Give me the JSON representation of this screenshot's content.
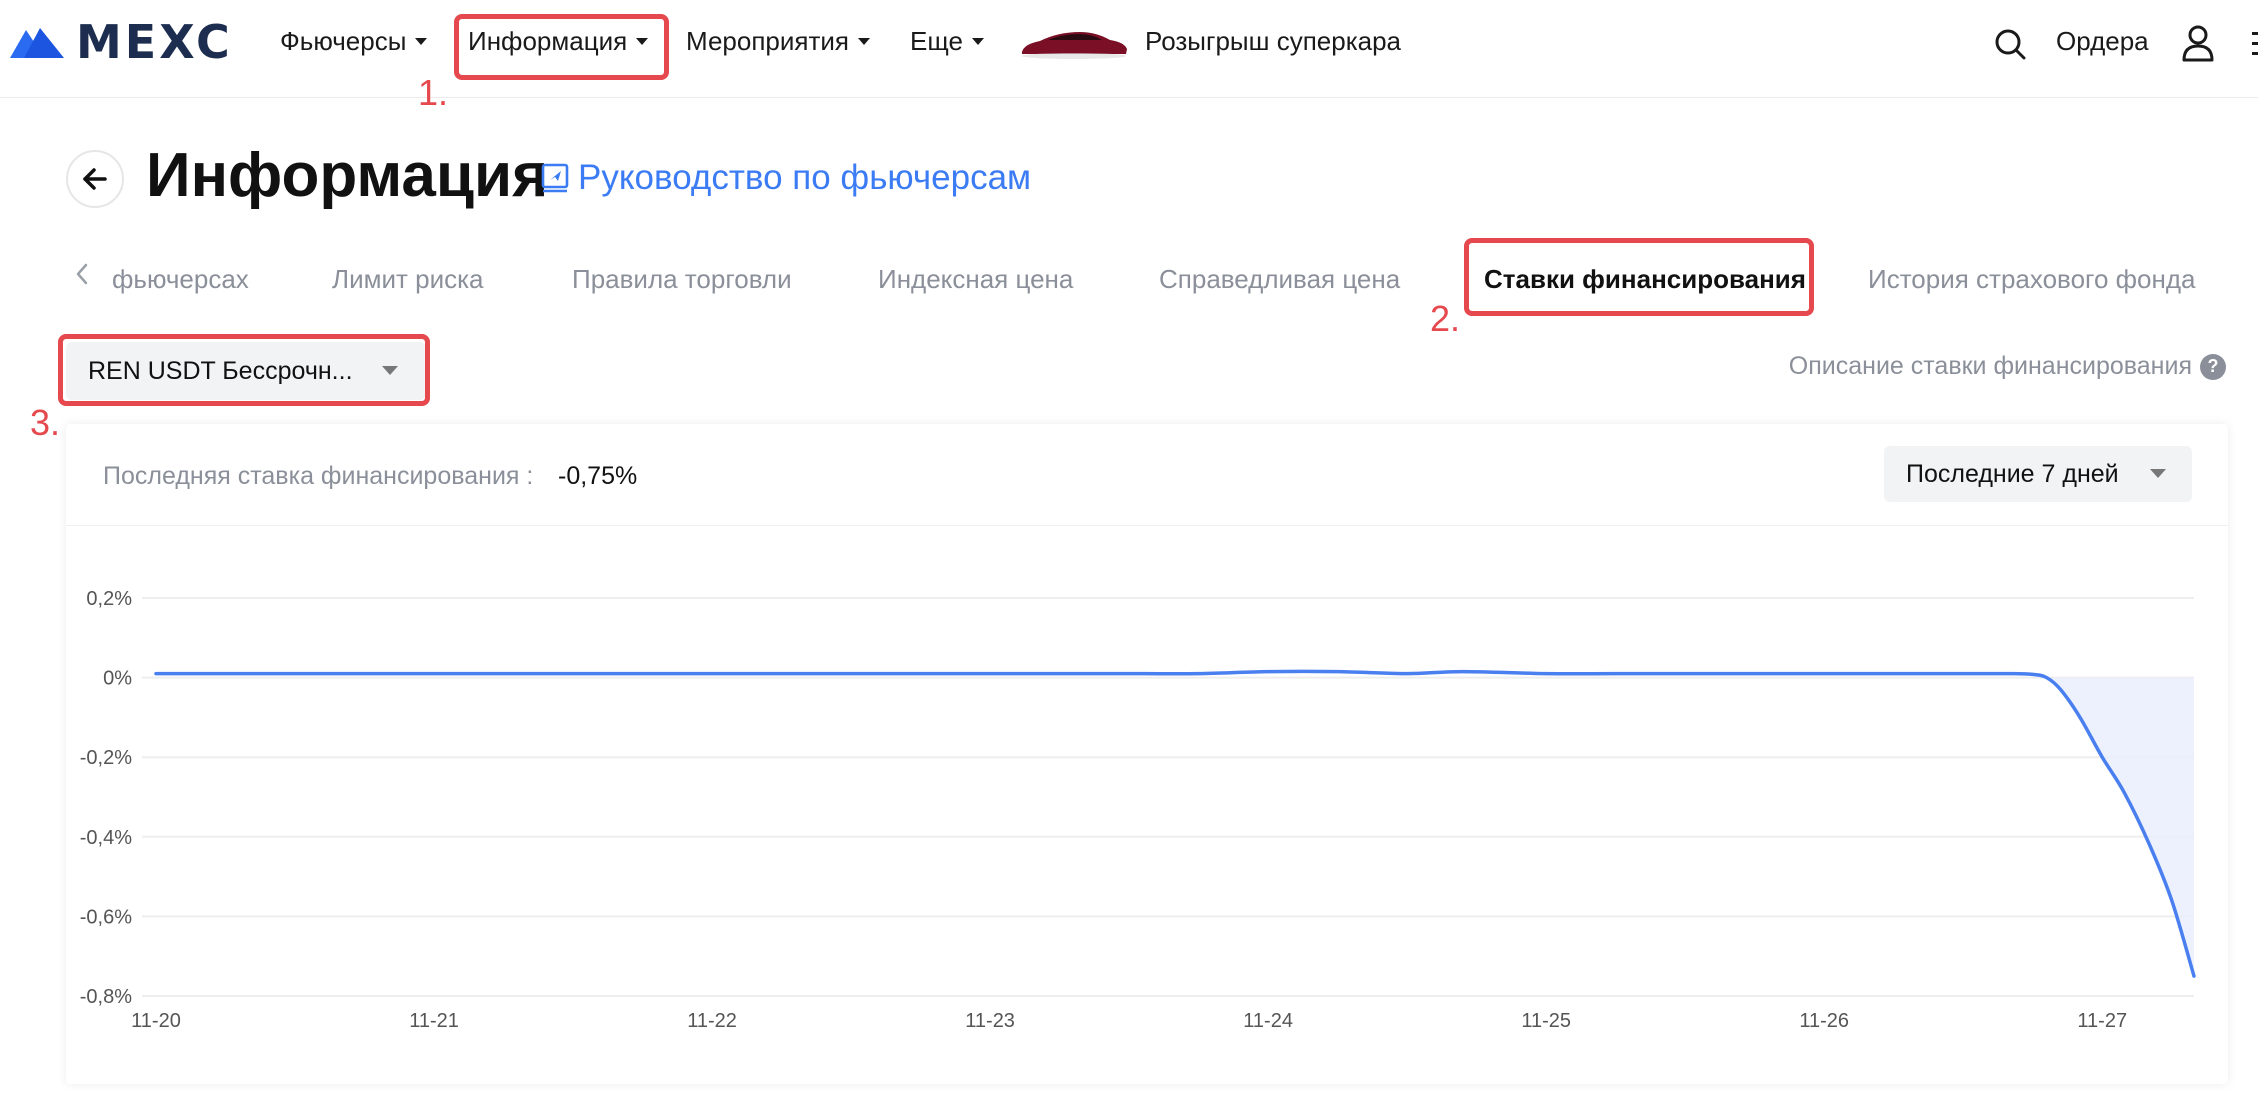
{
  "nav": {
    "logo_text": "MEXC",
    "items": [
      {
        "label": "Фьючерсы"
      },
      {
        "label": "Информация"
      },
      {
        "label": "Мероприятия"
      },
      {
        "label": "Еще"
      }
    ],
    "promo_label": "Розыгрыш суперкара",
    "orders_label": "Ордера"
  },
  "steps": [
    "1.",
    "2.",
    "3."
  ],
  "header": {
    "title": "Информация",
    "guide_label": "Руководство по фьючерсам"
  },
  "tabs": [
    {
      "label": "фьючерсах",
      "active": false
    },
    {
      "label": "Лимит риска",
      "active": false
    },
    {
      "label": "Правила торговли",
      "active": false
    },
    {
      "label": "Индексная цена",
      "active": false
    },
    {
      "label": "Справедливая цена",
      "active": false
    },
    {
      "label": "Ставки финансирования",
      "active": true
    },
    {
      "label": "История страхового фонда",
      "active": false
    }
  ],
  "pair_select": {
    "value": "REN USDT Бессрочн..."
  },
  "rate_description": "Описание ставки финансирования",
  "card": {
    "last_rate_label": "Последняя ставка финансирования :",
    "last_rate_value": "-0,75%",
    "period_value": "Последние 7 дней"
  },
  "colors": {
    "accent": "#3b7cf5",
    "highlight": "#e5484d",
    "line": "#4a7ff0",
    "area": "#e8eefc"
  },
  "chart_data": {
    "type": "area",
    "title": "",
    "xlabel": "",
    "ylabel": "",
    "y_tick_labels": [
      "0,2%",
      "0%",
      "-0,2%",
      "-0,4%",
      "-0,6%",
      "-0,8%"
    ],
    "y_ticks": [
      0.2,
      0,
      -0.2,
      -0.4,
      -0.6,
      -0.8
    ],
    "ylim": [
      -0.8,
      0.2
    ],
    "x_tick_labels": [
      "11-20",
      "11-21",
      "11-22",
      "11-23",
      "11-24",
      "11-25",
      "11-26",
      "11-27"
    ],
    "xlim": [
      0,
      7.33
    ],
    "grid": true,
    "series": [
      {
        "x": [
          0,
          0.5,
          1,
          1.5,
          2,
          2.5,
          3,
          3.5,
          3.75,
          4,
          4.25,
          4.5,
          4.7,
          5,
          5.25,
          5.5,
          5.75,
          6,
          6.5,
          6.67,
          6.75,
          6.8,
          6.85,
          6.92,
          7.0,
          7.08,
          7.17,
          7.25,
          7.33
        ],
        "y": [
          0.01,
          0.01,
          0.01,
          0.01,
          0.01,
          0.01,
          0.01,
          0.01,
          0.01,
          0.015,
          0.015,
          0.01,
          0.015,
          0.01,
          0.01,
          0.01,
          0.01,
          0.01,
          0.01,
          0.01,
          0.008,
          0.0,
          -0.03,
          -0.1,
          -0.2,
          -0.29,
          -0.42,
          -0.56,
          -0.75
        ]
      }
    ]
  }
}
